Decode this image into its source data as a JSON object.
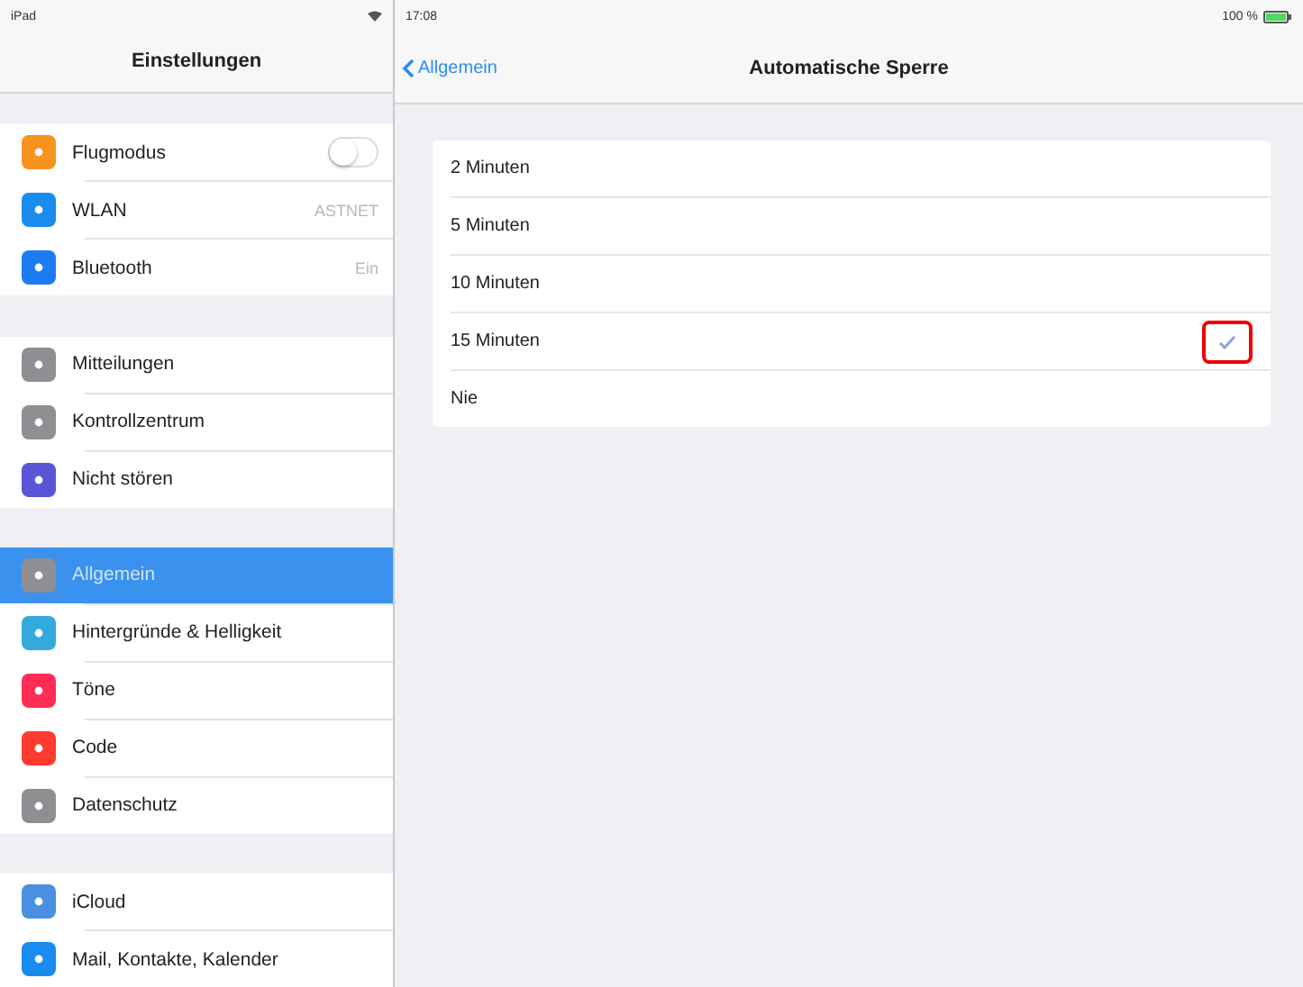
{
  "status_bar": {
    "device": "iPad",
    "time": "17:08",
    "battery": "100 %"
  },
  "sidebar": {
    "title": "Einstellungen",
    "groups": [
      {
        "items": [
          {
            "label": "Flugmodus",
            "color": "#f7931e",
            "kind": "toggle",
            "on": false,
            "selected": false
          },
          {
            "label": "WLAN",
            "color": "#1a8cf0",
            "kind": "value",
            "value": "ASTNET",
            "selected": false
          },
          {
            "label": "Bluetooth",
            "color": "#1a7cf0",
            "kind": "value",
            "value": "Ein",
            "selected": false
          }
        ]
      },
      {
        "items": [
          {
            "label": "Mitteilungen",
            "color": "#8e8e93",
            "kind": "plain",
            "selected": false
          },
          {
            "label": "Kontrollzentrum",
            "color": "#8e8e93",
            "kind": "plain",
            "selected": false
          },
          {
            "label": "Nicht stören",
            "color": "#5856d6",
            "kind": "plain",
            "selected": false
          }
        ]
      },
      {
        "items": [
          {
            "label": "Allgemein",
            "color": "#8e8e93",
            "kind": "plain",
            "selected": true
          },
          {
            "label": "Hintergründe & Helligkeit",
            "color": "#34aadc",
            "kind": "plain",
            "selected": false
          },
          {
            "label": "Töne",
            "color": "#ff2d55",
            "kind": "plain",
            "selected": false
          },
          {
            "label": "Code",
            "color": "#ff3b30",
            "kind": "plain",
            "selected": false
          },
          {
            "label": "Datenschutz",
            "color": "#8e8e93",
            "kind": "plain",
            "selected": false
          }
        ]
      },
      {
        "items": [
          {
            "label": "iCloud",
            "color": "#4a90e2",
            "kind": "plain",
            "selected": false
          },
          {
            "label": "Mail, Kontakte, Kalender",
            "color": "#1a8cf0",
            "kind": "plain",
            "selected": false
          }
        ]
      }
    ]
  },
  "detail": {
    "back": "Allgemein",
    "title": "Automatische Sperre",
    "options": [
      {
        "label": "2 Minuten",
        "selected": false
      },
      {
        "label": "5 Minuten",
        "selected": false
      },
      {
        "label": "10 Minuten",
        "selected": false
      },
      {
        "label": "15 Minuten",
        "selected": true
      },
      {
        "label": "Nie",
        "selected": false
      }
    ]
  }
}
